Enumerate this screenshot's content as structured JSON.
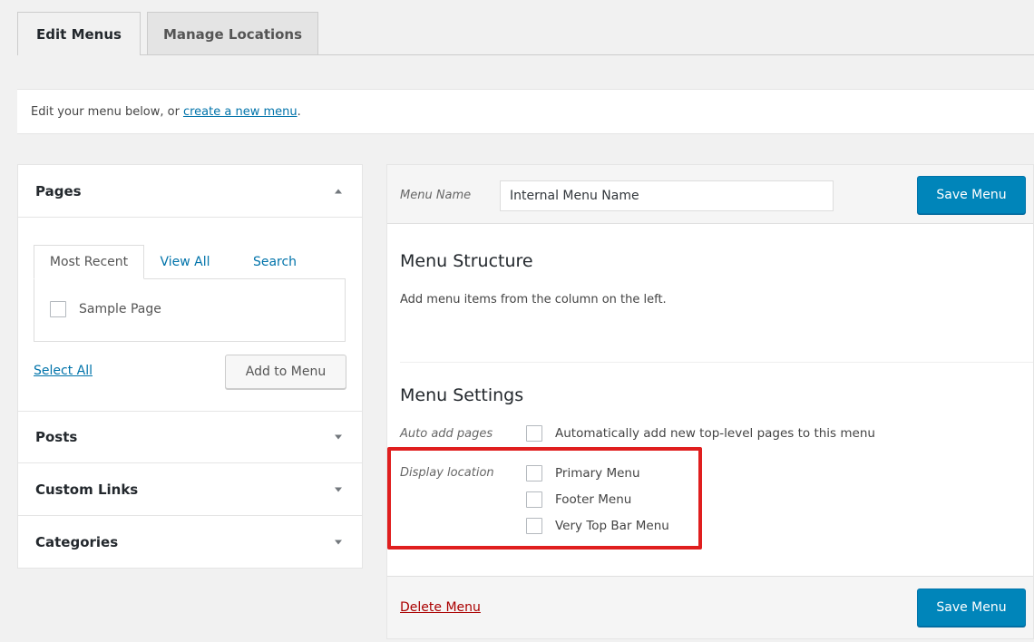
{
  "tabs": [
    {
      "label": "Edit Menus"
    },
    {
      "label": "Manage Locations"
    }
  ],
  "notice": {
    "text": "Edit your menu below, or",
    "link_label": "create a new menu",
    "trailing": "."
  },
  "left": {
    "pages": {
      "title": "Pages",
      "tabs": [
        "Most Recent",
        "View All",
        "Search"
      ],
      "items": [
        {
          "label": "Sample Page",
          "checked": false
        }
      ],
      "select_all": "Select All",
      "add_button": "Add to Menu"
    },
    "sections": [
      {
        "title": "Posts"
      },
      {
        "title": "Custom Links"
      },
      {
        "title": "Categories"
      }
    ]
  },
  "right": {
    "menu_name_label": "Menu Name",
    "menu_name_value": "Internal Menu Name",
    "save_label": "Save Menu",
    "structure": {
      "title": "Menu Structure",
      "description": "Add menu items from the column on the left."
    },
    "settings": {
      "title": "Menu Settings",
      "auto_add_label": "Auto add pages",
      "auto_add_option": "Automatically add new top-level pages to this menu",
      "display_location_label": "Display location",
      "locations": [
        "Primary Menu",
        "Footer Menu",
        "Very Top Bar Menu"
      ]
    },
    "delete_label": "Delete Menu"
  },
  "colors": {
    "accent": "#0085ba",
    "link": "#0073aa",
    "delete": "#a00000",
    "highlight_box": "#e01e1e"
  }
}
